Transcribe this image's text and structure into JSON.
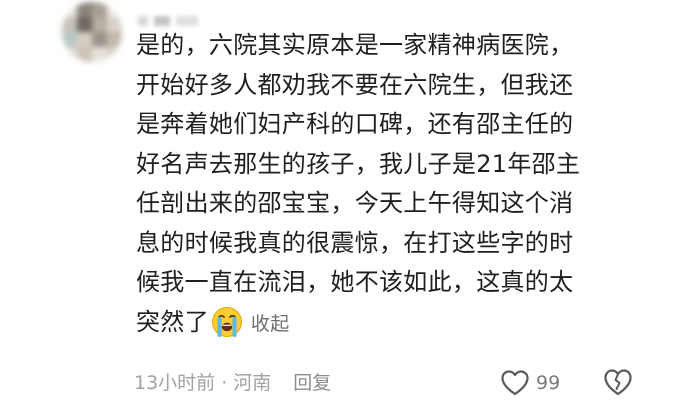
{
  "comment": {
    "lines": [
      "是的，六院其实原本是一家精神病医院，",
      "开始好多人都劝我不要在六院生，但我还",
      "是奔着她们妇产科的口碑，还有邵主任的",
      "好名声去那生的孩子，我儿子是21年邵主",
      "任剖出来的邵宝宝，今天上午得知这个消",
      "息的时候我真的很震惊，在打这些字的时",
      "候我一直在流泪，她不该如此，这真的太",
      "突然了"
    ],
    "collapse_label": "收起",
    "emoji": "loudly-crying-face"
  },
  "meta": {
    "time_location": "13小时前 · 河南",
    "reply_label": "回复",
    "like_count": "99"
  },
  "icons": {
    "like": "heart-icon",
    "dislike": "broken-heart-icon"
  },
  "colors": {
    "text": "#1f1f1f",
    "meta": "#a2a2a2",
    "icon": "#5a5a5a"
  }
}
